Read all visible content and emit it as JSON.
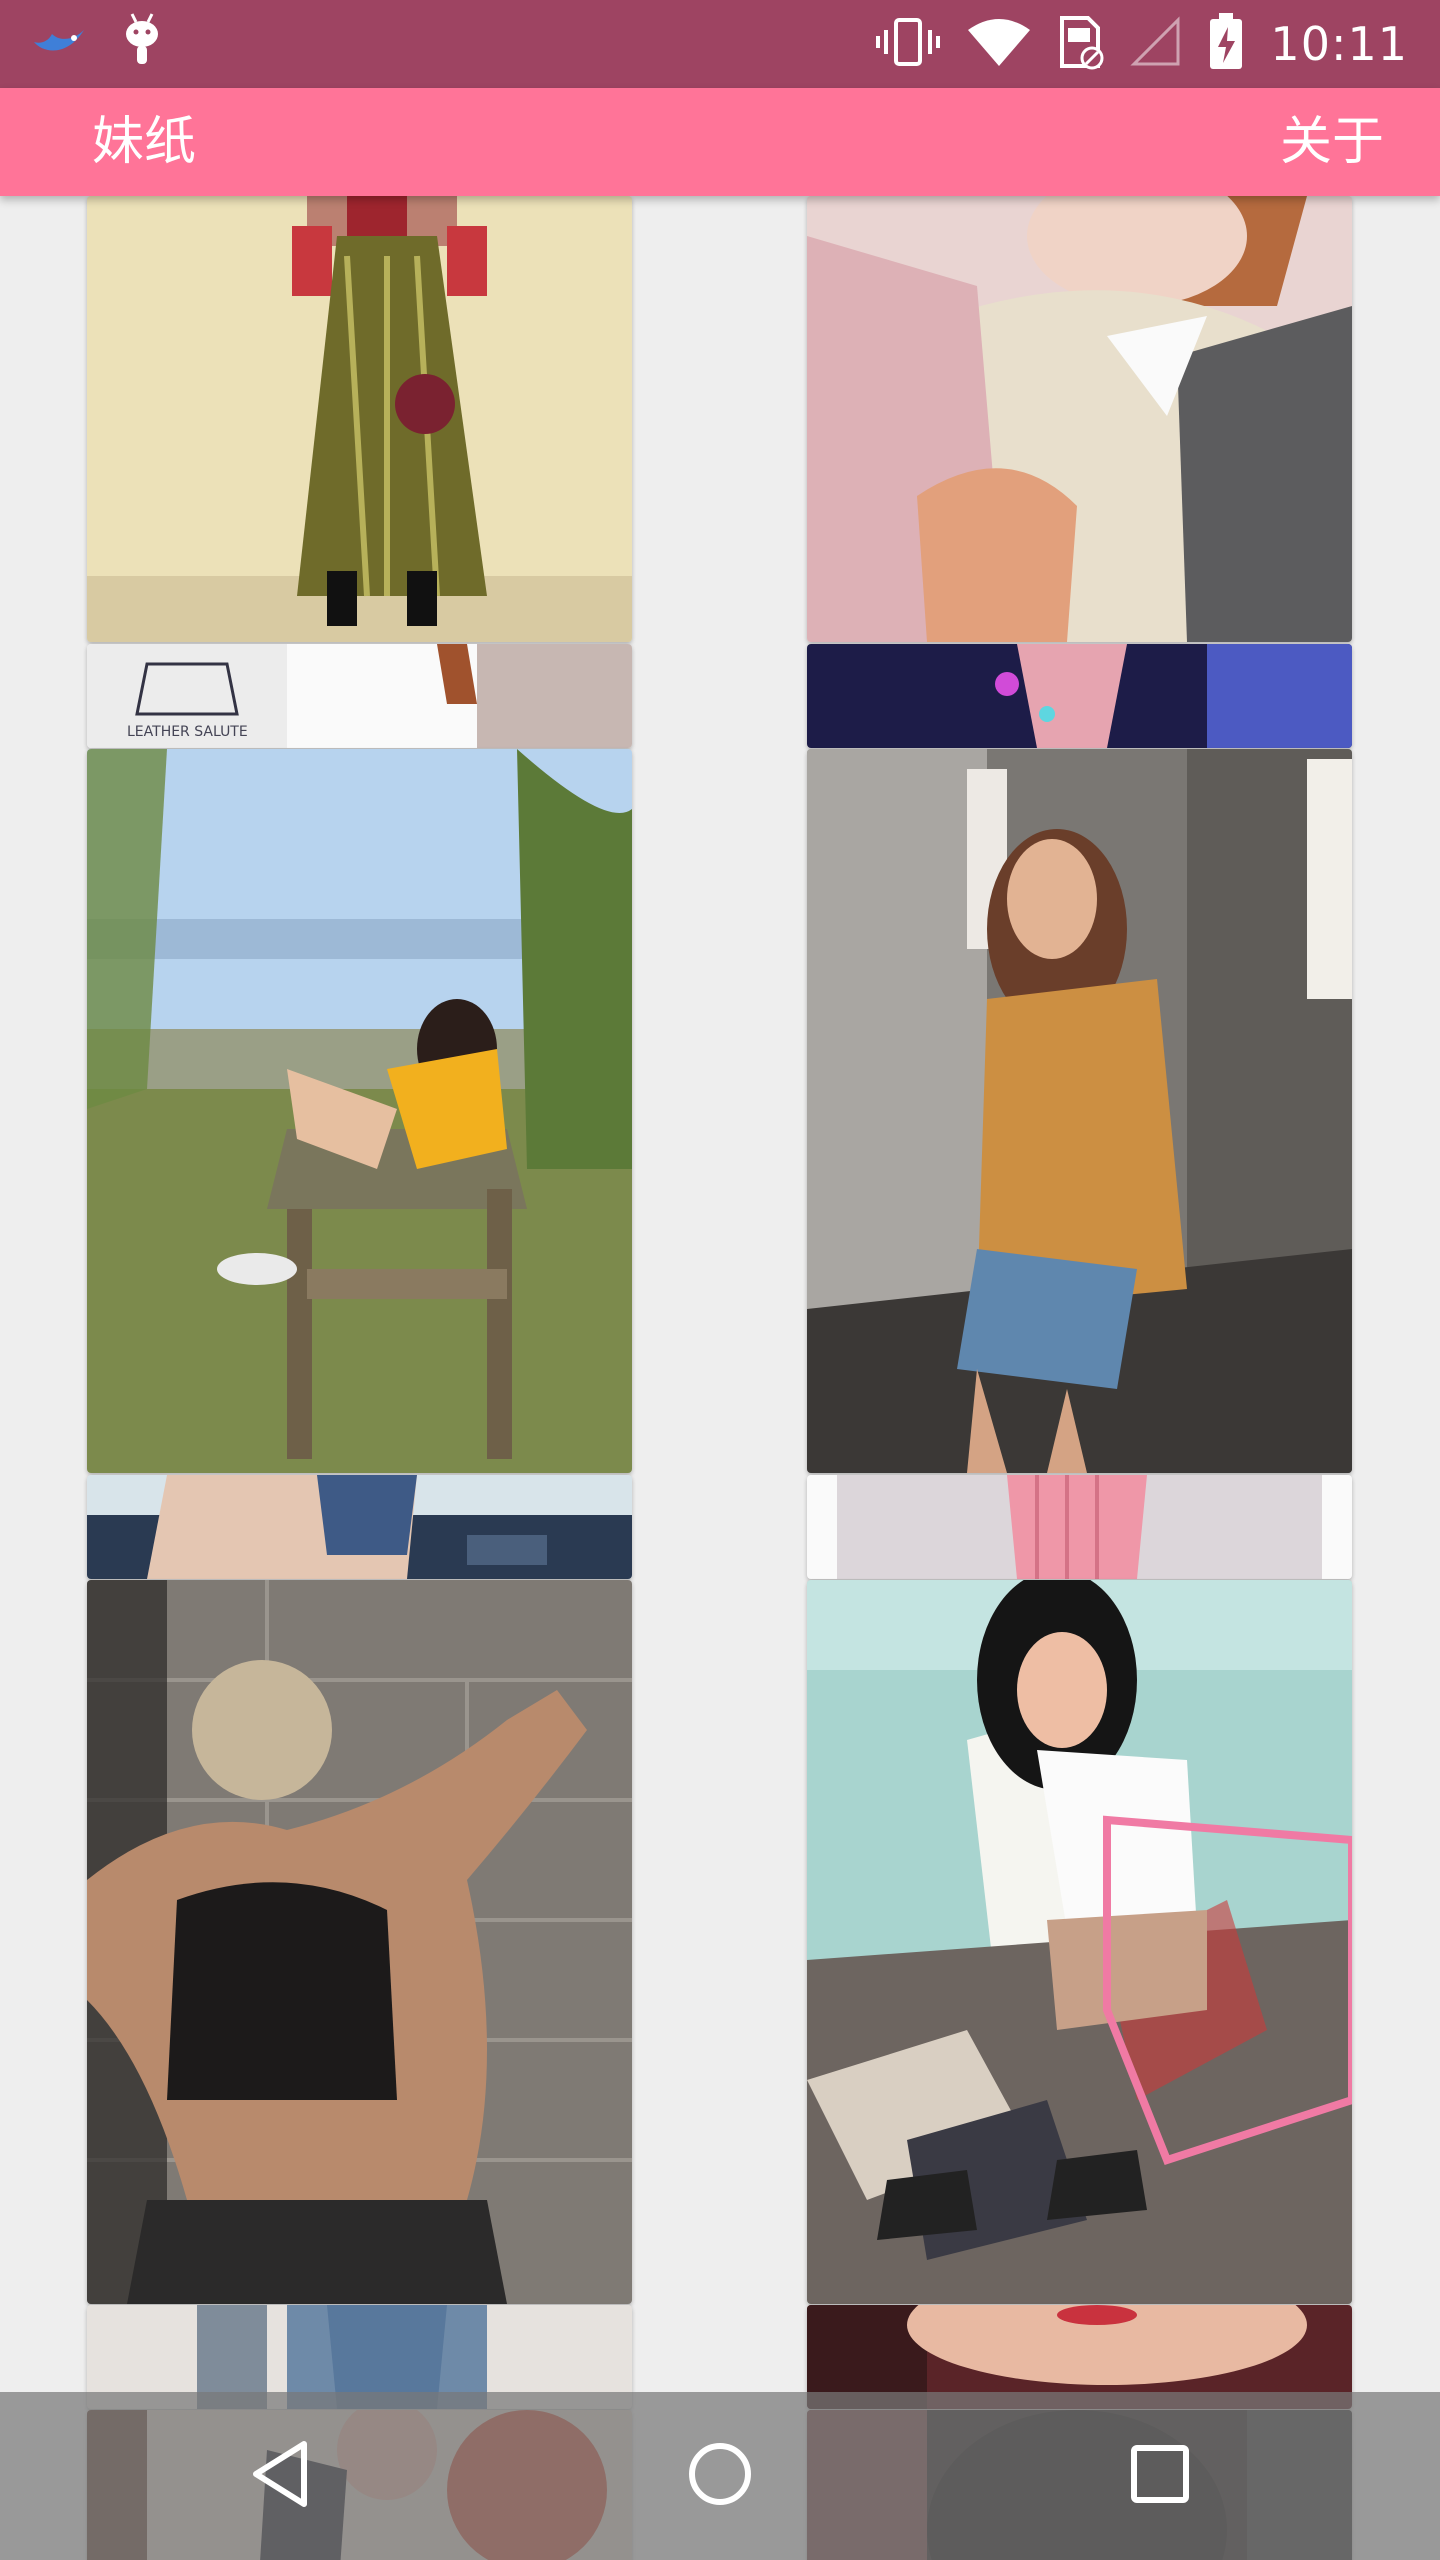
{
  "status_bar": {
    "time": "10:11",
    "left_icons": [
      "bird-app-icon",
      "android-debug-icon"
    ],
    "right_icons": [
      "vibrate-icon",
      "wifi-icon",
      "sim-no-card-icon",
      "signal-icon",
      "battery-charging-icon"
    ]
  },
  "app_bar": {
    "title": "妹纸",
    "action": "关于",
    "color": "#ff7498"
  },
  "gallery": {
    "left_column": [
      {
        "name": "photo-skirt-outfit"
      },
      {
        "name": "photo-leather-salute-shirt"
      },
      {
        "name": "photo-beach-chair-girl"
      },
      {
        "name": "photo-car-denim"
      },
      {
        "name": "photo-back-workout"
      },
      {
        "name": "photo-jeans-street"
      },
      {
        "name": "photo-umbrella-costume"
      }
    ],
    "right_column": [
      {
        "name": "photo-pink-cardigan"
      },
      {
        "name": "photo-neon-lights"
      },
      {
        "name": "photo-elevator-girl"
      },
      {
        "name": "photo-pink-dress"
      },
      {
        "name": "photo-shopping-cart-girl"
      },
      {
        "name": "photo-red-lips"
      },
      {
        "name": "photo-dark-hair"
      }
    ]
  },
  "nav_bar": {
    "buttons": [
      "back-icon",
      "home-icon",
      "recents-icon"
    ]
  }
}
